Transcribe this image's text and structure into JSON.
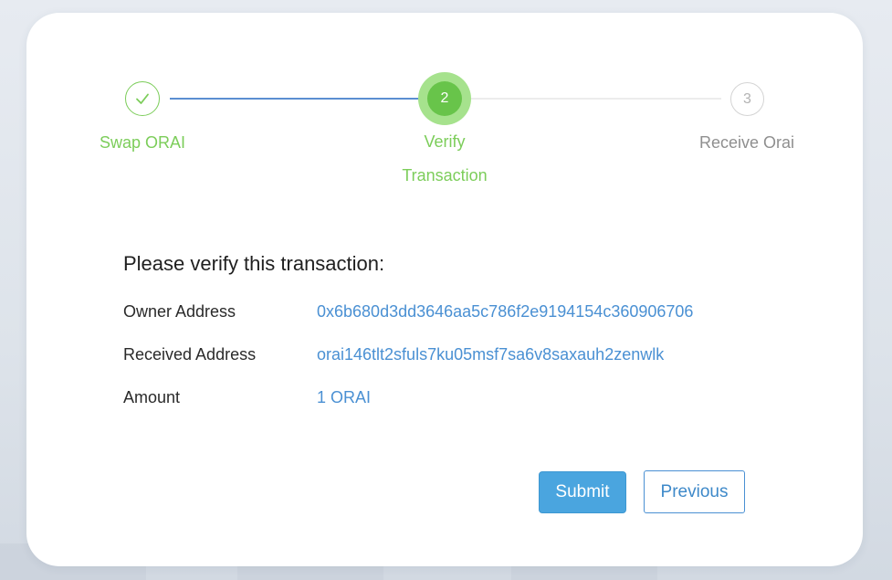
{
  "stepper": {
    "steps": [
      {
        "label": "Swap ORAI",
        "state": "completed",
        "icon": "check-icon"
      },
      {
        "label": "Verify Transaction",
        "number": "2",
        "state": "active"
      },
      {
        "label": "Receive Orai",
        "number": "3",
        "state": "pending"
      }
    ]
  },
  "verify": {
    "heading": "Please verify this transaction:",
    "rows": [
      {
        "label": "Owner Address",
        "value": "0x6b680d3dd3646aa5c786f2e9194154c360906706"
      },
      {
        "label": "Received Address",
        "value": "orai146tlt2sfuls7ku05msf7sa6v8saxauh2zenwlk"
      },
      {
        "label": "Amount",
        "value": "1 ORAI"
      }
    ]
  },
  "actions": {
    "submit_label": "Submit",
    "previous_label": "Previous"
  },
  "colors": {
    "success_green": "#7ccd5a",
    "active_green": "#68c44a",
    "link_blue": "#4a90d3",
    "submit_blue": "#4aa5df"
  }
}
